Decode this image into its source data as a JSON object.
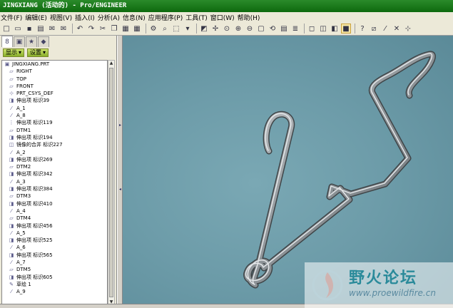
{
  "window": {
    "title": "JINGXIANG (活动的) - Pro/ENGINEER"
  },
  "menu": [
    "文件(F)",
    "编辑(E)",
    "视图(V)",
    "插入(I)",
    "分析(A)",
    "信息(N)",
    "应用程序(P)",
    "工具(T)",
    "窗口(W)",
    "帮助(H)"
  ],
  "toolbar_icons": [
    "new-icon",
    "open-icon",
    "save-icon",
    "print-icon",
    "email-icon",
    "email-pdf-icon",
    "undo-icon",
    "redo-icon",
    "cut-icon",
    "copy-icon",
    "paste-icon",
    "paste-special-icon",
    "regenerate-icon",
    "find-icon",
    "select-box-icon",
    "select-dropdown-icon",
    "repaint-icon",
    "spin-center-icon",
    "orient-icon",
    "zoom-in-icon",
    "zoom-out-icon",
    "refit-icon",
    "reorient-icon",
    "saved-views-icon",
    "layers-icon",
    "wireframe-icon",
    "hidden-line-icon",
    "no-hidden-icon",
    "shading-icon",
    "help-context-icon",
    "datum-planes-icon",
    "datum-axes-icon",
    "datum-points-icon",
    "csys-icon"
  ],
  "left_panel": {
    "show_button": "显示",
    "settings_button": "设置",
    "tree": [
      {
        "icon": "part-icon",
        "label": "JINGXIANG.PRT"
      },
      {
        "icon": "datum-plane-icon",
        "label": "RIGHT"
      },
      {
        "icon": "datum-plane-icon",
        "label": "TOP"
      },
      {
        "icon": "datum-plane-icon",
        "label": "FRONT"
      },
      {
        "icon": "csys-icon",
        "label": "PRT_CSYS_DEF"
      },
      {
        "icon": "extrude-icon",
        "label": "伸出项 标识39"
      },
      {
        "icon": "axis-icon",
        "label": "A_1"
      },
      {
        "icon": "axis-icon",
        "label": "A_8"
      },
      {
        "icon": "pattern-icon",
        "label": "伸出项 标识119"
      },
      {
        "icon": "datum-plane-icon",
        "label": "DTM1"
      },
      {
        "icon": "extrude-icon",
        "label": "伸出项 标识194"
      },
      {
        "icon": "mirror-merge-icon",
        "label": "镜像的合并 标识227"
      },
      {
        "icon": "axis-icon",
        "label": "A_2"
      },
      {
        "icon": "extrude-icon",
        "label": "伸出项 标识269"
      },
      {
        "icon": "datum-plane-icon",
        "label": "DTM2"
      },
      {
        "icon": "extrude-icon",
        "label": "伸出项 标识342"
      },
      {
        "icon": "axis-icon",
        "label": "A_3"
      },
      {
        "icon": "extrude-icon",
        "label": "伸出项 标识384"
      },
      {
        "icon": "datum-plane-icon",
        "label": "DTM3"
      },
      {
        "icon": "extrude-icon",
        "label": "伸出项 标识410"
      },
      {
        "icon": "axis-icon",
        "label": "A_4"
      },
      {
        "icon": "datum-plane-icon",
        "label": "DTM4"
      },
      {
        "icon": "extrude-icon",
        "label": "伸出项 标识456"
      },
      {
        "icon": "axis-icon",
        "label": "A_5"
      },
      {
        "icon": "extrude-icon",
        "label": "伸出项 标识525"
      },
      {
        "icon": "axis-icon",
        "label": "A_6"
      },
      {
        "icon": "extrude-icon",
        "label": "伸出项 标识565"
      },
      {
        "icon": "axis-icon",
        "label": "A_7"
      },
      {
        "icon": "datum-plane-icon",
        "label": "DTM5"
      },
      {
        "icon": "extrude-icon",
        "label": "伸出项 标识605"
      },
      {
        "icon": "sketch-icon",
        "label": "草绘 1"
      },
      {
        "icon": "axis-icon",
        "label": "A_9"
      }
    ]
  },
  "watermark": {
    "title": "野火论坛",
    "url": "www.proewildfire.cn"
  },
  "colors": {
    "viewport_bg": "#6d9ca9",
    "title_bg": "#1a7a1a",
    "model": "#9aa0a4"
  }
}
